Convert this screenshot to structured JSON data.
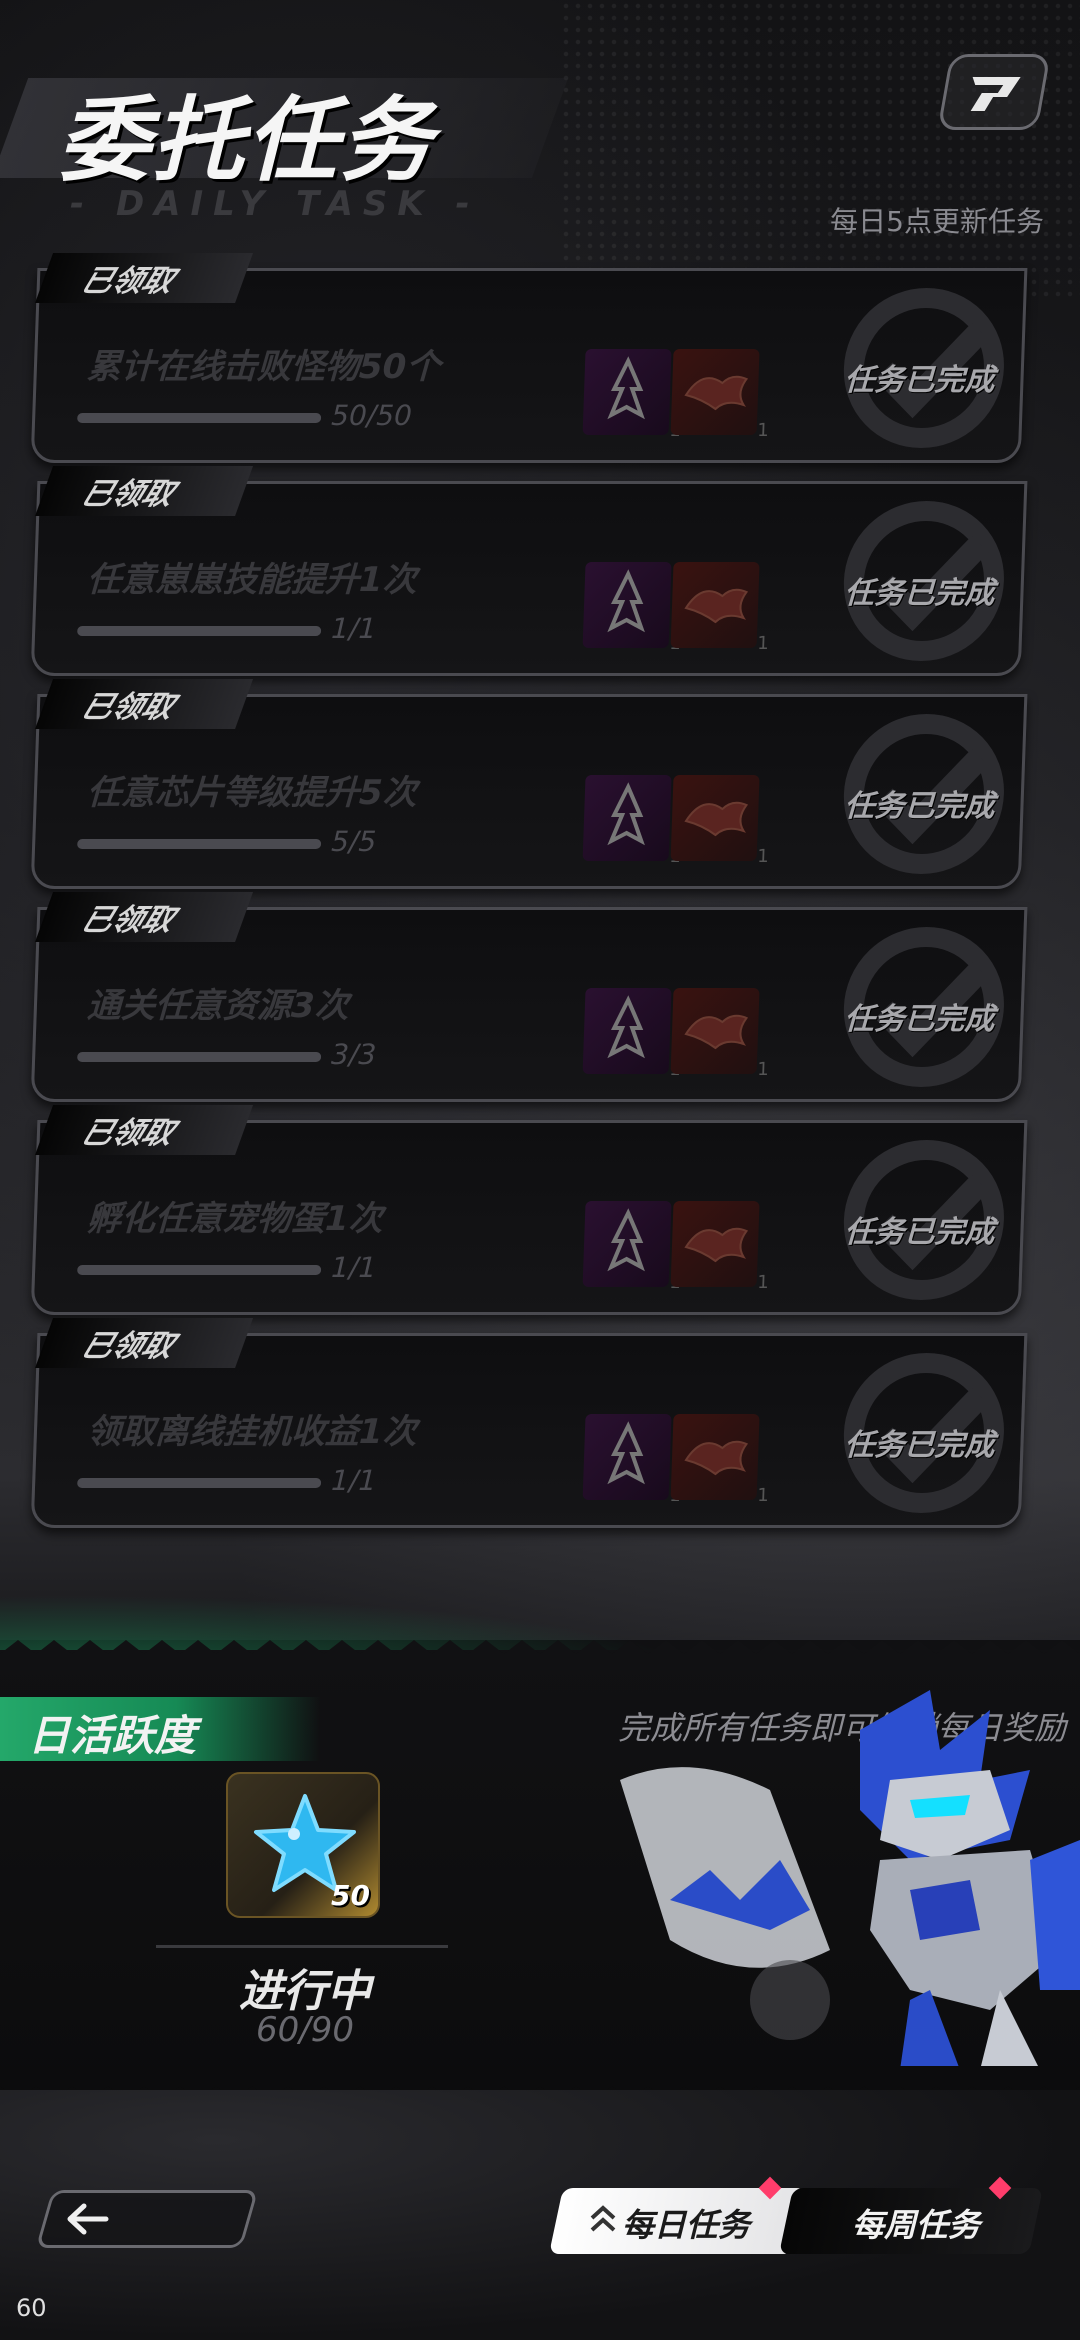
{
  "header": {
    "title": "委托任务",
    "subtitle": "- DAILY TASK -",
    "refresh_text": "每日5点更新任务"
  },
  "tasks": [
    {
      "claimed_label": "已领取",
      "name": "累计在线击败怪物50个",
      "progress_text": "50/50",
      "progress": 1.0,
      "status": "任务已完成",
      "rewards": [
        {
          "icon": "blade-crest-icon",
          "count": "1"
        },
        {
          "icon": "fire-emblem-icon",
          "count": "1"
        }
      ]
    },
    {
      "claimed_label": "已领取",
      "name": "任意崽崽技能提升1次",
      "progress_text": "1/1",
      "progress": 1.0,
      "status": "任务已完成",
      "rewards": [
        {
          "icon": "blade-crest-icon",
          "count": "1"
        },
        {
          "icon": "fire-emblem-icon",
          "count": "1"
        }
      ]
    },
    {
      "claimed_label": "已领取",
      "name": "任意芯片等级提升5次",
      "progress_text": "5/5",
      "progress": 1.0,
      "status": "任务已完成",
      "rewards": [
        {
          "icon": "blade-crest-icon",
          "count": "1"
        },
        {
          "icon": "fire-emblem-icon",
          "count": "1"
        }
      ]
    },
    {
      "claimed_label": "已领取",
      "name": "通关任意资源3次",
      "progress_text": "3/3",
      "progress": 1.0,
      "status": "任务已完成",
      "rewards": [
        {
          "icon": "blade-crest-icon",
          "count": "1"
        },
        {
          "icon": "fire-emblem-icon",
          "count": "1"
        }
      ]
    },
    {
      "claimed_label": "已领取",
      "name": "孵化任意宠物蛋1次",
      "progress_text": "1/1",
      "progress": 1.0,
      "status": "任务已完成",
      "rewards": [
        {
          "icon": "blade-crest-icon",
          "count": "1"
        },
        {
          "icon": "fire-emblem-icon",
          "count": "1"
        }
      ]
    },
    {
      "claimed_label": "已领取",
      "name": "领取离线挂机收益1次",
      "progress_text": "1/1",
      "progress": 1.0,
      "status": "任务已完成",
      "rewards": [
        {
          "icon": "blade-crest-icon",
          "count": "1"
        },
        {
          "icon": "fire-emblem-icon",
          "count": "1"
        }
      ]
    }
  ],
  "activity": {
    "title": "日活跃度",
    "hint": "完成所有任务即可解锁每日奖励",
    "chest": {
      "icon": "blue-star-icon",
      "count": "50"
    },
    "status": "进行中",
    "progress_text": "60/90"
  },
  "footer": {
    "back_icon": "arrow-left-icon",
    "tab_daily_icon": "chevron-up-icon",
    "tab_daily": "每日任务",
    "tab_weekly": "每周任务",
    "fps": "60"
  },
  "colors": {
    "accent_green": "#24a86a",
    "badge_red": "#ff3d6b",
    "card_border": "#4a4a50"
  }
}
